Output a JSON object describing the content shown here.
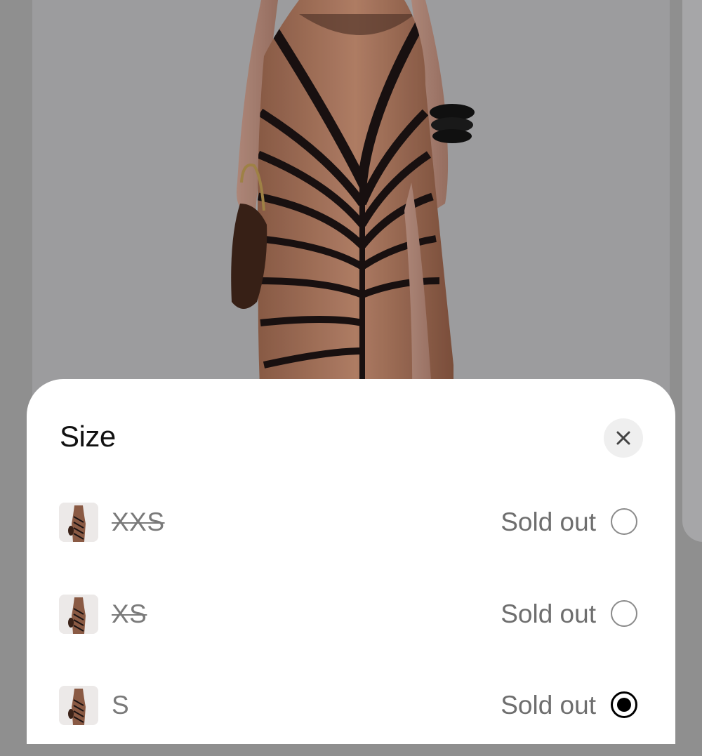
{
  "product_page": {
    "image_alt": "Model wearing printed maxi dress with side slit"
  },
  "size_sheet": {
    "title": "Size",
    "close_icon": "close-icon",
    "options": [
      {
        "label": "XXS",
        "status": "Sold out",
        "sold_out": true,
        "selected": false
      },
      {
        "label": "XS",
        "status": "Sold out",
        "sold_out": true,
        "selected": false
      },
      {
        "label": "S",
        "status": "Sold out",
        "sold_out": true,
        "selected": true
      }
    ]
  },
  "colors": {
    "sheet_background": "#ffffff",
    "backdrop": "#8f8f8f",
    "text_primary": "#111111",
    "text_muted": "#6e6e6e",
    "radio_selected": "#000000"
  }
}
